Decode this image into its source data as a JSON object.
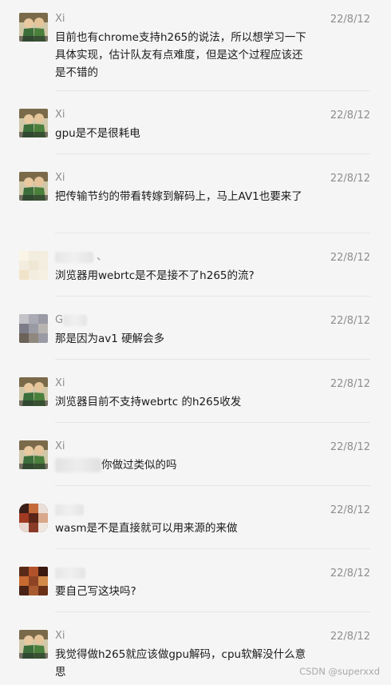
{
  "messages": [
    {
      "name": "Xi",
      "time": "22/8/12",
      "avatar": "anime-avatar",
      "text": "目前也有chrome支持h265的说法，所以想学习一下具体实现，估计队友有点难度，但是这个过程应该还是不错的"
    },
    {
      "name": "Xi",
      "time": "22/8/12",
      "avatar": "anime-avatar",
      "text": "gpu是不是很耗电"
    },
    {
      "name": "Xi",
      "time": "22/8/12",
      "avatar": "anime-avatar",
      "text": "把传输节约的带看转嫁到解码上，马上AV1也要来了"
    },
    {
      "name": "、",
      "time": "22/8/12",
      "avatar": "blurred-avatar-light",
      "text": "浏览器用webrtc是不是接不了h265的流?"
    },
    {
      "name": "G",
      "time": "22/8/12",
      "avatar": "blurred-avatar-gray",
      "text": "那是因为av1 硬解会多"
    },
    {
      "name": "Xi",
      "time": "22/8/12",
      "avatar": "anime-avatar",
      "text": "浏览器目前不支持webrtc 的h265收发"
    },
    {
      "name": "Xi",
      "time": "22/8/12",
      "avatar": "anime-avatar",
      "text": "你做过类似的吗"
    },
    {
      "name": "",
      "time": "22/8/12",
      "avatar": "blurred-avatar-red",
      "text": "wasm是不是直接就可以用来源的来做"
    },
    {
      "name": "",
      "time": "22/8/12",
      "avatar": "blurred-avatar-brown",
      "text": "要自己写这块吗?"
    },
    {
      "name": "Xi",
      "time": "22/8/12",
      "avatar": "anime-avatar",
      "text": "我觉得做h265就应该做gpu解码，cpu软解没什么意思"
    }
  ],
  "watermark": "CSDN @superxxd",
  "colors": {
    "background": "#f5f5f5",
    "meta": "#8e8e8e",
    "text": "#1a1a1a",
    "separator": "#e6e6e6"
  }
}
